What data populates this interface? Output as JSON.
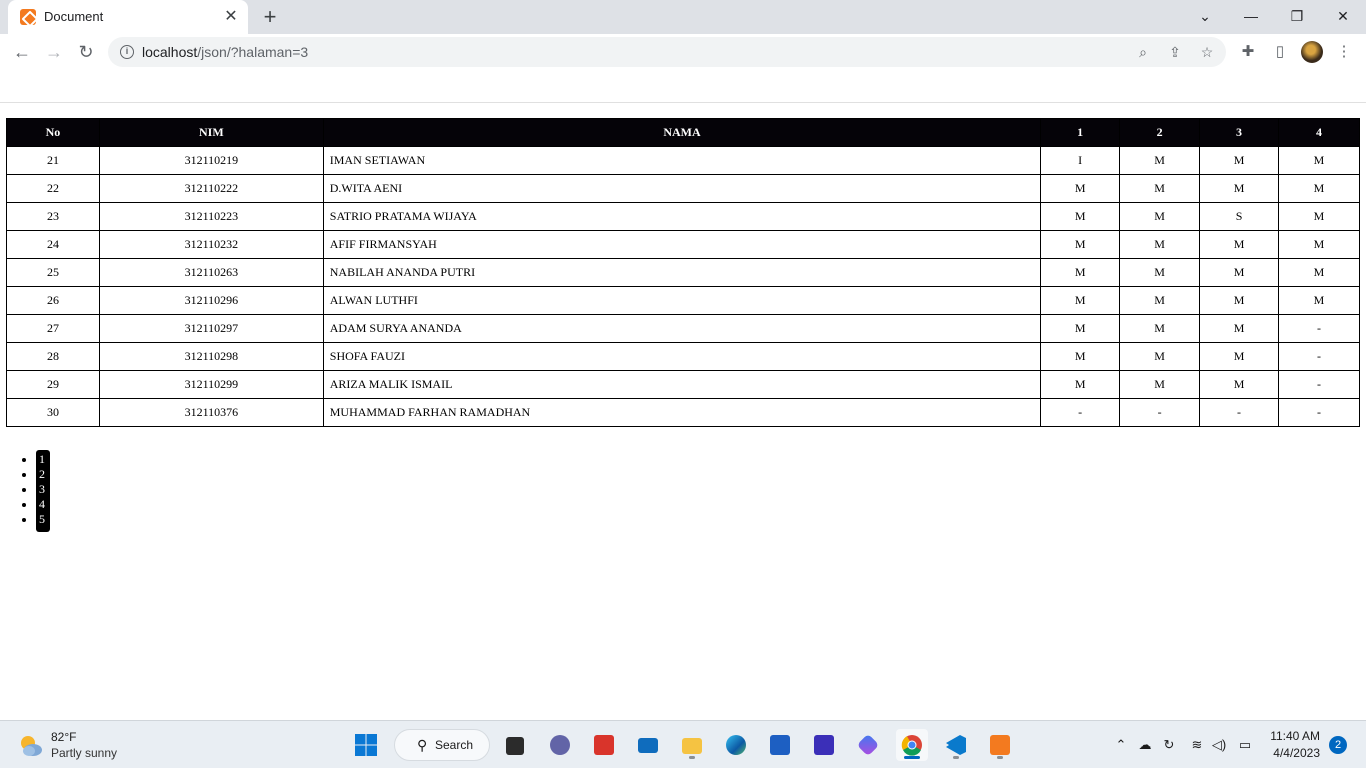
{
  "browser": {
    "tab_title": "Document",
    "tab_close_glyph": "✕",
    "new_tab_glyph": "+",
    "url_host": "localhost",
    "url_path": "/json/?halaman=3",
    "window_controls": {
      "menu": "⌄",
      "minimize": "—",
      "restore": "❐",
      "close": "✕"
    },
    "nav": {
      "back": "←",
      "forward": "→",
      "reload": "↻"
    },
    "omnibox_icons": {
      "info": "i",
      "zoom": "⌕",
      "share": "⇪",
      "bookmark": "☆"
    },
    "toolbar_icons": {
      "extensions": "✚",
      "side_panel": "▯",
      "menu": "⋮"
    }
  },
  "table": {
    "headers": [
      "No",
      "NIM",
      "NAMA",
      "1",
      "2",
      "3",
      "4"
    ],
    "rows": [
      {
        "no": "21",
        "nim": "312110219",
        "nama": "IMAN SETIAWAN",
        "c1": "I",
        "c2": "M",
        "c3": "M",
        "c4": "M"
      },
      {
        "no": "22",
        "nim": "312110222",
        "nama": "D.WITA AENI",
        "c1": "M",
        "c2": "M",
        "c3": "M",
        "c4": "M"
      },
      {
        "no": "23",
        "nim": "312110223",
        "nama": "SATRIO PRATAMA WIJAYA",
        "c1": "M",
        "c2": "M",
        "c3": "S",
        "c4": "M"
      },
      {
        "no": "24",
        "nim": "312110232",
        "nama": "AFIF FIRMANSYAH",
        "c1": "M",
        "c2": "M",
        "c3": "M",
        "c4": "M"
      },
      {
        "no": "25",
        "nim": "312110263",
        "nama": "NABILAH ANANDA PUTRI",
        "c1": "M",
        "c2": "M",
        "c3": "M",
        "c4": "M"
      },
      {
        "no": "26",
        "nim": "312110296",
        "nama": "ALWAN LUTHFI",
        "c1": "M",
        "c2": "M",
        "c3": "M",
        "c4": "M"
      },
      {
        "no": "27",
        "nim": "312110297",
        "nama": "ADAM SURYA ANANDA",
        "c1": "M",
        "c2": "M",
        "c3": "M",
        "c4": "-"
      },
      {
        "no": "28",
        "nim": "312110298",
        "nama": "SHOFA FAUZI",
        "c1": "M",
        "c2": "M",
        "c3": "M",
        "c4": "-"
      },
      {
        "no": "29",
        "nim": "312110299",
        "nama": "ARIZA MALIK ISMAIL",
        "c1": "M",
        "c2": "M",
        "c3": "M",
        "c4": "-"
      },
      {
        "no": "30",
        "nim": "312110376",
        "nama": "MUHAMMAD FARHAN RAMADHAN",
        "c1": "-",
        "c2": "-",
        "c3": "-",
        "c4": "-"
      }
    ]
  },
  "pagination": [
    "1",
    "2",
    "3",
    "4",
    "5"
  ],
  "taskbar": {
    "weather_temp": "82°F",
    "weather_desc": "Partly sunny",
    "search_label": "Search",
    "apps": [
      "start",
      "search",
      "task-view",
      "teams-chat",
      "app-red",
      "mail",
      "file-explorer",
      "edge",
      "store",
      "app-purple",
      "copilot",
      "chrome",
      "vscode",
      "xampp"
    ],
    "clock_time": "11:40 AM",
    "clock_date": "4/4/2023",
    "notifications": "2"
  },
  "colors": {
    "header_bg": "#050308",
    "tabstrip_bg": "#dee1e6",
    "taskbar_bg": "#e9eef3",
    "accent": "#0067c0"
  }
}
